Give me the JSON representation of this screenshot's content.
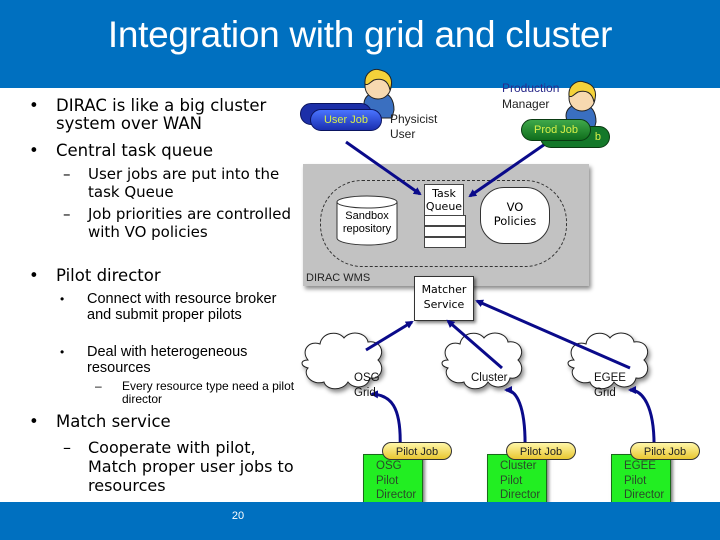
{
  "slide": {
    "title": "Integration with grid and cluster",
    "page_number": "20",
    "colors": {
      "header": "#0070c0",
      "footer": "#0070c0",
      "arrow": "#0a0a8a",
      "pilot_director": "#22ee22"
    }
  },
  "bullets": [
    {
      "level": 1,
      "text": "DIRAC is like a big cluster system over WAN"
    },
    {
      "level": 1,
      "text": "Central task queue"
    },
    {
      "level": 2,
      "text": "User jobs are put into the task Queue"
    },
    {
      "level": 2,
      "text": "Job priorities are controlled with VO policies"
    },
    {
      "level": 1,
      "text": "Pilot director"
    },
    {
      "level": 2,
      "text": "Connect with resource broker and submit proper pilots"
    },
    {
      "level": 2,
      "text": "Deal with heterogeneous resources"
    },
    {
      "level": 3,
      "text": "Every resource type need a pilot director"
    },
    {
      "level": 1,
      "text": "Match service"
    },
    {
      "level": 2,
      "text": "Cooperate with pilot, Match proper user jobs to resources"
    }
  ],
  "bullet_markers": {
    "l1": "•",
    "l2": "–",
    "l2a": "•",
    "l3": "–"
  },
  "diagram": {
    "physicist": {
      "label_line1": "Physicist",
      "label_line2": "User",
      "job_label": "User Job"
    },
    "production": {
      "label_line1": "Production",
      "label_line2": "Manager",
      "job_label": "Prod Job",
      "back_job_fragment": "b"
    },
    "wms": {
      "label": "DIRAC WMS",
      "sandbox_line1": "Sandbox",
      "sandbox_line2": "repository",
      "task_queue_line1": "Task",
      "task_queue_line2": "Queue",
      "vo_line1": "VO",
      "vo_line2": "Policies"
    },
    "matcher": {
      "line1": "Matcher",
      "line2": "Service"
    },
    "resources": [
      {
        "cloud_line1": "OSG",
        "cloud_line2": "Grid",
        "pilot_job": "Pilot Job",
        "director_line1": "OSG",
        "director_line2": "Pilot",
        "director_line3": "Director"
      },
      {
        "cloud_line1": "Cluster",
        "cloud_line2": "",
        "pilot_job": "Pilot Job",
        "director_line1": "Cluster",
        "director_line2": "Pilot",
        "director_line3": "Director"
      },
      {
        "cloud_line1": "EGEE",
        "cloud_line2": "Grid",
        "pilot_job": "Pilot Job",
        "director_line1": "EGEE",
        "director_line2": "Pilot",
        "director_line3": "Director"
      }
    ]
  }
}
